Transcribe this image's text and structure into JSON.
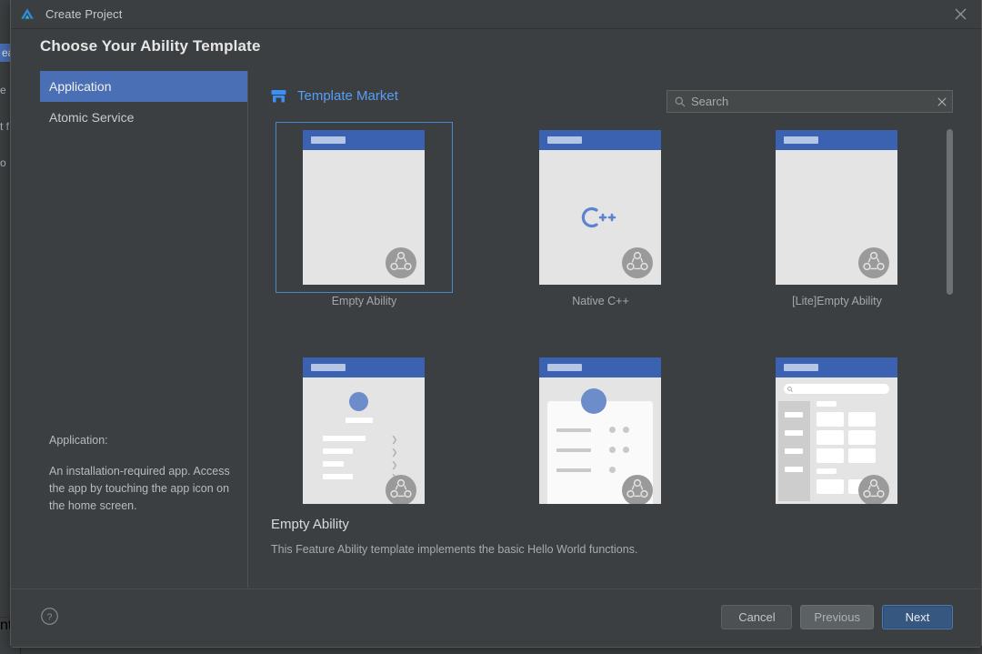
{
  "backdrop": {
    "left_fragments": [
      "ea",
      "e",
      "t f",
      "o",
      "nt"
    ]
  },
  "titlebar": {
    "app_icon": "deveco-logo-icon",
    "title": "Create Project",
    "close_label": "close-icon"
  },
  "wizard": {
    "heading": "Choose Your Ability Template"
  },
  "sidebar": {
    "items": [
      {
        "label": "Application",
        "selected": true
      },
      {
        "label": "Atomic Service",
        "selected": false
      }
    ],
    "description_title": "Application:",
    "description_body": "An installation-required app. Access the app by touching the app icon on the home screen."
  },
  "template_pane": {
    "market_icon": "store-icon",
    "market_label": "Template Market",
    "search": {
      "icon": "search-icon",
      "placeholder": "Search",
      "value": "",
      "clear_icon": "clear-x-icon"
    },
    "cards": [
      {
        "caption": "Empty Ability",
        "art": "blank",
        "selected": true
      },
      {
        "caption": "Native C++",
        "art": "cpp",
        "selected": false
      },
      {
        "caption": "[Lite]Empty Ability",
        "art": "blank",
        "selected": false
      },
      {
        "caption": "",
        "art": "profile-list",
        "selected": false
      },
      {
        "caption": "",
        "art": "avatar-card",
        "selected": false
      },
      {
        "caption": "",
        "art": "dashboard-grid",
        "selected": false
      }
    ],
    "detail": {
      "title": "Empty Ability",
      "description": "This Feature Ability template implements the basic Hello World functions."
    }
  },
  "footer": {
    "help_icon": "help-question-icon",
    "buttons": [
      {
        "label": "Cancel",
        "style": "secondary"
      },
      {
        "label": "Previous",
        "style": "muted"
      },
      {
        "label": "Next",
        "style": "primary"
      }
    ]
  },
  "colors": {
    "dialog_bg": "#3c3f41",
    "accent_blue": "#4a6fb5",
    "link_blue": "#589df6",
    "primary_button": "#365880",
    "selection_border": "#4a88c7"
  }
}
